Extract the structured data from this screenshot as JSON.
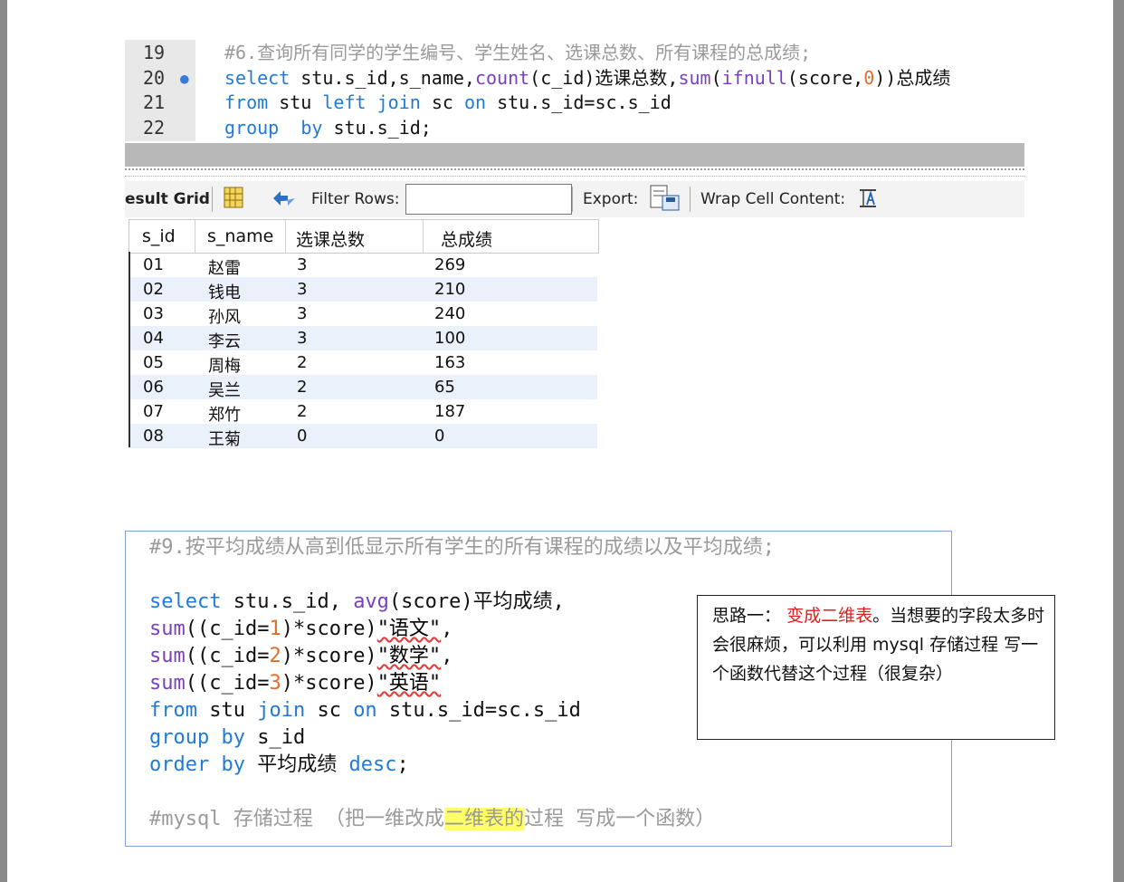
{
  "code1": {
    "lines": [
      {
        "num": "19",
        "parts": [
          {
            "t": "#6.查询所有同学的学生编号、学生姓名、选课总数、所有课程的总成绩;",
            "c": "cmt"
          }
        ]
      },
      {
        "num": "20",
        "parts": [
          {
            "t": "select",
            "c": "kw"
          },
          {
            "t": " stu.s_id,s_name,",
            "c": "plain"
          },
          {
            "t": "count",
            "c": "fn"
          },
          {
            "t": "(c_id)选课总数,",
            "c": "plain"
          },
          {
            "t": "sum",
            "c": "fn"
          },
          {
            "t": "(",
            "c": "plain"
          },
          {
            "t": "ifnull",
            "c": "fn"
          },
          {
            "t": "(score,",
            "c": "plain"
          },
          {
            "t": "0",
            "c": "num"
          },
          {
            "t": "))总成绩",
            "c": "plain"
          }
        ]
      },
      {
        "num": "21",
        "parts": [
          {
            "t": "from",
            "c": "kw"
          },
          {
            "t": " stu ",
            "c": "plain"
          },
          {
            "t": "left",
            "c": "kw"
          },
          {
            "t": " ",
            "c": "plain"
          },
          {
            "t": "join",
            "c": "kw"
          },
          {
            "t": " sc ",
            "c": "plain"
          },
          {
            "t": "on",
            "c": "kw"
          },
          {
            "t": " stu.s_id=sc.s_id",
            "c": "plain"
          }
        ]
      },
      {
        "num": "22",
        "parts": [
          {
            "t": "group",
            "c": "kw"
          },
          {
            "t": "  ",
            "c": "plain"
          },
          {
            "t": "by",
            "c": "kw"
          },
          {
            "t": " stu.s_id;",
            "c": "plain"
          }
        ]
      }
    ],
    "breakpoint_icon": "breakpoint-dot-icon"
  },
  "toolbar": {
    "result_grid": "esult Grid",
    "filter_rows": "Filter Rows:",
    "filter_value": "",
    "export": "Export:",
    "wrap": "Wrap Cell Content:",
    "icons": [
      "grid-toggle-icon",
      "refresh-icon",
      "export-icon",
      "wrap-cell-icon"
    ]
  },
  "grid": {
    "columns": [
      "s_id",
      "s_name",
      "选课总数",
      "总成绩"
    ],
    "rows": [
      [
        "01",
        "赵雷",
        "3",
        "269"
      ],
      [
        "02",
        "钱电",
        "3",
        "210"
      ],
      [
        "03",
        "孙风",
        "3",
        "240"
      ],
      [
        "04",
        "李云",
        "3",
        "100"
      ],
      [
        "05",
        "周梅",
        "2",
        "163"
      ],
      [
        "06",
        "吴兰",
        "2",
        "65"
      ],
      [
        "07",
        "郑竹",
        "2",
        "187"
      ],
      [
        "08",
        "王菊",
        "0",
        "0"
      ]
    ]
  },
  "code2": {
    "lines": [
      [
        {
          "t": "#9.按平均成绩从高到低显示所有学生的所有课程的成绩以及平均成绩;",
          "c": "cmt"
        }
      ],
      [],
      [
        {
          "t": "select",
          "c": "kw"
        },
        {
          "t": " stu.s_id, ",
          "c": "plain"
        },
        {
          "t": "avg",
          "c": "fn"
        },
        {
          "t": "(score)平均成绩,",
          "c": "plain"
        }
      ],
      [
        {
          "t": "sum",
          "c": "fn"
        },
        {
          "t": "((c_id=",
          "c": "plain"
        },
        {
          "t": "1",
          "c": "num"
        },
        {
          "t": ")*score)",
          "c": "plain"
        },
        {
          "t": "\"语文\"",
          "c": "sq"
        },
        {
          "t": ",",
          "c": "plain"
        }
      ],
      [
        {
          "t": "sum",
          "c": "fn"
        },
        {
          "t": "((c_id=",
          "c": "plain"
        },
        {
          "t": "2",
          "c": "num"
        },
        {
          "t": ")*score)",
          "c": "plain"
        },
        {
          "t": "\"数学\"",
          "c": "sq"
        },
        {
          "t": ",",
          "c": "plain"
        }
      ],
      [
        {
          "t": "sum",
          "c": "fn"
        },
        {
          "t": "((c_id=",
          "c": "plain"
        },
        {
          "t": "3",
          "c": "num"
        },
        {
          "t": ")*score)",
          "c": "plain"
        },
        {
          "t": "\"英语\"",
          "c": "sq"
        }
      ],
      [
        {
          "t": "from",
          "c": "kw"
        },
        {
          "t": " stu ",
          "c": "plain"
        },
        {
          "t": "join",
          "c": "kw"
        },
        {
          "t": " sc ",
          "c": "plain"
        },
        {
          "t": "on",
          "c": "kw"
        },
        {
          "t": " stu.s_id=sc.s_id",
          "c": "plain"
        }
      ],
      [
        {
          "t": "group",
          "c": "kw"
        },
        {
          "t": " ",
          "c": "plain"
        },
        {
          "t": "by",
          "c": "kw"
        },
        {
          "t": " s_id",
          "c": "plain"
        }
      ],
      [
        {
          "t": "order",
          "c": "kw"
        },
        {
          "t": " ",
          "c": "plain"
        },
        {
          "t": "by",
          "c": "kw"
        },
        {
          "t": " 平均成绩 ",
          "c": "plain"
        },
        {
          "t": "desc",
          "c": "kw"
        },
        {
          "t": ";",
          "c": "plain"
        }
      ],
      [],
      [
        {
          "t": "#mysql 存储过程 （把一维改成",
          "c": "cmt"
        },
        {
          "t": "二维表的",
          "c": "cmt hl"
        },
        {
          "t": "过程 写成一个函数）",
          "c": "cmt"
        }
      ]
    ]
  },
  "note": {
    "prefix": "思路一：",
    "highlight": "变成二维表",
    "rest": "。当想要的字段太多时会很麻烦，可以利用 mysql 存储过程 写一个函数代替这个过程（很复杂）"
  }
}
